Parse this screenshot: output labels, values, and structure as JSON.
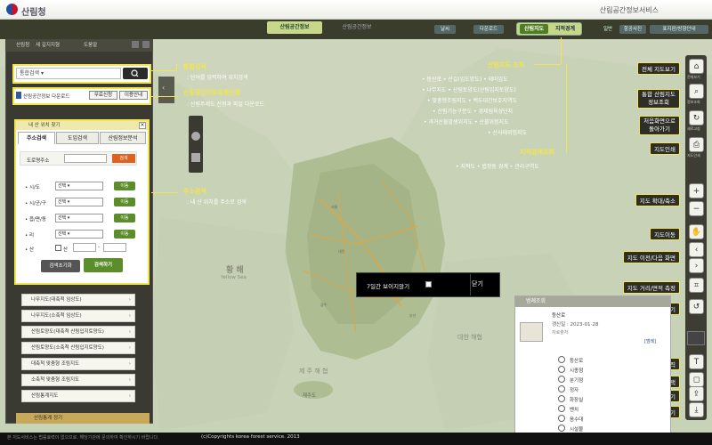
{
  "header": {
    "logo_text": "산림청",
    "service_title": "산림공간정보서비스"
  },
  "topbar": {
    "tabs": [
      "산림공간정보",
      "산림공간정보"
    ],
    "right_buttons": [
      "날씨",
      "다운로드",
      "일반",
      "항공사진",
      "표지판/방향안내"
    ],
    "toggle": [
      "산림지도",
      "지적경계"
    ]
  },
  "left_panel": {
    "bar_links": [
      "산림청",
      "새 길지지형",
      "도움말"
    ],
    "search": {
      "combo": "통합검색"
    },
    "download": {
      "label": "산림공간정보 다운로드",
      "btn_apply": "무료신청",
      "btn_guide": "이용안내"
    },
    "location": {
      "title": "내 산 위치 찾기",
      "tabs": [
        "주소검색",
        "도입검색",
        "산림정보분석"
      ],
      "road_label": "도로명주소",
      "road_search": "검색",
      "rows": [
        {
          "label": "시/도",
          "select": "선택",
          "btn": "이동"
        },
        {
          "label": "시/군/구",
          "select": "선택",
          "btn": "이동"
        },
        {
          "label": "읍/면/동",
          "select": "선택",
          "btn": "이동"
        },
        {
          "label": "리",
          "select": "선택",
          "btn": "이동"
        }
      ],
      "mountain_label": "산",
      "mountain_check": "산",
      "reset": "검색초기화",
      "go": "검색하기"
    },
    "map_list": [
      "나무지도(대축척 임상도)",
      "나무지도(소축척 임상도)",
      "산림토양도(대축척 산림입지토양도)",
      "산림토양도(소축척 산림입지토양도)",
      "대축척 맞춤형 조림지도",
      "소축척 맞춤형 조림지도",
      "산림통계지도"
    ],
    "bottom_item": "산림통계 정기"
  },
  "callouts": {
    "integrated_title": "통합검색",
    "integrated_desc": ": 단어를 입력하여 위치검색",
    "download_title": "산림공간자료유통신청",
    "download_desc": ": 산림주제도 신청과 파일 다운로드",
    "address_title": "주소검색",
    "address_desc": ": 내 산 위치를 주소로 검색",
    "forest_map_title": "산림지도 조회",
    "forest_map_items": [
      "• 등산로   • 산길(임도망도)   • 테마임도",
      "• 나무지도   • 산림토양도(산림입지토양도)",
      "• 맞춤형조림지도   • 백두대간보호지역도",
      "• 산림기능구분도   • 경제림육성단지",
      "• 과거산불발생위치도   • 산불위험지도",
      "• 산사태위험지도"
    ],
    "cadastral_title": "지적경계조회",
    "cadastral_items": "• 지적도   • 법정동 경계   • 관리구역도"
  },
  "right_toolbar": [
    {
      "label": "전체 지도보기",
      "icon_text": "전체보기"
    },
    {
      "label": "통합 산림지도\n정보조회",
      "icon_text": "정보조회"
    },
    {
      "label": "처음화면으로\n돌아가기",
      "icon_text": "새로고침"
    },
    {
      "label": "지도인쇄",
      "icon_text": "지도인쇄"
    },
    {
      "label": "지도 확대/축소",
      "icon_text": ""
    },
    {
      "label": "지도이동",
      "icon_text": ""
    },
    {
      "label": "지도 이전/다음 화면",
      "icon_text": ""
    },
    {
      "label": "지도 거리/면적 측정",
      "icon_text": ""
    },
    {
      "label": "도구지우기",
      "icon_text": ""
    },
    {
      "label": "글자입력",
      "icon_text": "T"
    },
    {
      "label": "도형선택",
      "icon_text": ""
    },
    {
      "label": "GIS파일 불러오기",
      "icon_text": ""
    },
    {
      "label": "GIS파일저장하기",
      "icon_text": ""
    }
  ],
  "popup": {
    "text": "7일간 보이지않기",
    "close": "닫기"
  },
  "legend": {
    "title": "범례조회",
    "thumb_name": "등산로",
    "updated": "갱신일 : 2023-01-28",
    "source": "자료출처",
    "link": "[범례]",
    "items": [
      "등산로",
      "시종점",
      "분기점",
      "정자",
      "화장실",
      "벤치",
      "음수대",
      "시설물"
    ]
  },
  "map_labels": {
    "yellow_sea": "황 해",
    "yellow_sea_en": "Yellow Sea",
    "east_sea": "대한 해협",
    "jeju_strait": "제 주 해 협",
    "jeju": "제주도"
  },
  "footer": {
    "left": "본 지도서비스는 법률효력이 없으므로, 해당기관에 문의하여 확인하시기 바랍니다.",
    "center": "(c)Copyrights korea forest service. 2013"
  }
}
